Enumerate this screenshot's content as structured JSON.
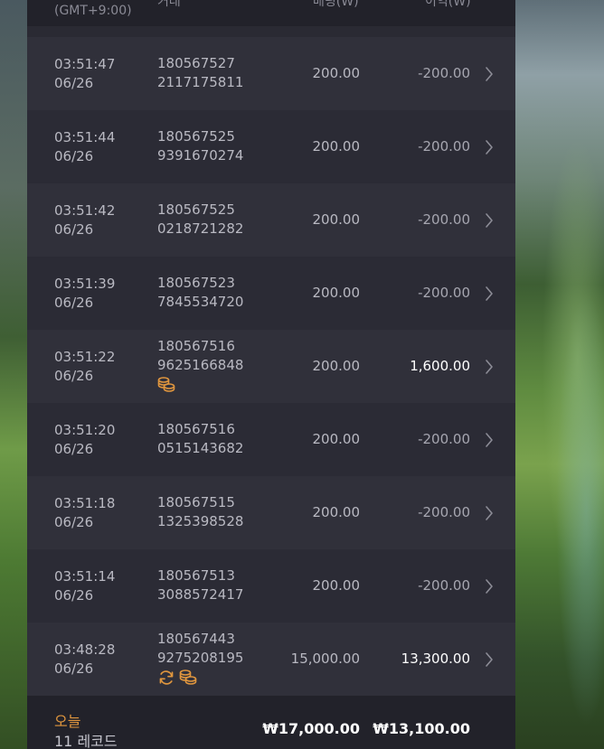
{
  "header": {
    "time_col_label": "(GMT+9:00)",
    "trade_col_label": "거래",
    "bet_col_label": "배팅(₩)",
    "profit_col_label": "이익(₩)"
  },
  "rows": [
    {
      "time": "03:51:47",
      "date": "06/26",
      "id_line1": "180567527",
      "id_line2": "2117175811",
      "bet": "200.00",
      "profit": "-200.00",
      "positive": false,
      "icons": []
    },
    {
      "time": "03:51:44",
      "date": "06/26",
      "id_line1": "180567525",
      "id_line2": "9391670274",
      "bet": "200.00",
      "profit": "-200.00",
      "positive": false,
      "icons": []
    },
    {
      "time": "03:51:42",
      "date": "06/26",
      "id_line1": "180567525",
      "id_line2": "0218721282",
      "bet": "200.00",
      "profit": "-200.00",
      "positive": false,
      "icons": []
    },
    {
      "time": "03:51:39",
      "date": "06/26",
      "id_line1": "180567523",
      "id_line2": "7845534720",
      "bet": "200.00",
      "profit": "-200.00",
      "positive": false,
      "icons": []
    },
    {
      "time": "03:51:22",
      "date": "06/26",
      "id_line1": "180567516",
      "id_line2": "9625166848",
      "bet": "200.00",
      "profit": "1,600.00",
      "positive": true,
      "icons": [
        "coins-icon"
      ]
    },
    {
      "time": "03:51:20",
      "date": "06/26",
      "id_line1": "180567516",
      "id_line2": "0515143682",
      "bet": "200.00",
      "profit": "-200.00",
      "positive": false,
      "icons": []
    },
    {
      "time": "03:51:18",
      "date": "06/26",
      "id_line1": "180567515",
      "id_line2": "1325398528",
      "bet": "200.00",
      "profit": "-200.00",
      "positive": false,
      "icons": []
    },
    {
      "time": "03:51:14",
      "date": "06/26",
      "id_line1": "180567513",
      "id_line2": "3088572417",
      "bet": "200.00",
      "profit": "-200.00",
      "positive": false,
      "icons": []
    },
    {
      "time": "03:48:28",
      "date": "06/26",
      "id_line1": "180567443",
      "id_line2": "9275208195",
      "bet": "15,000.00",
      "profit": "13,300.00",
      "positive": true,
      "icons": [
        "refresh-icon",
        "coins-icon"
      ]
    }
  ],
  "footer": {
    "today_label": "오늘",
    "record_count": "11 레코드",
    "total_bet": "₩17,000.00",
    "total_profit": "₩13,100.00"
  },
  "colors": {
    "accent": "#e0963e",
    "panel": "#2a2a33",
    "positive_text": "#ffffff"
  }
}
